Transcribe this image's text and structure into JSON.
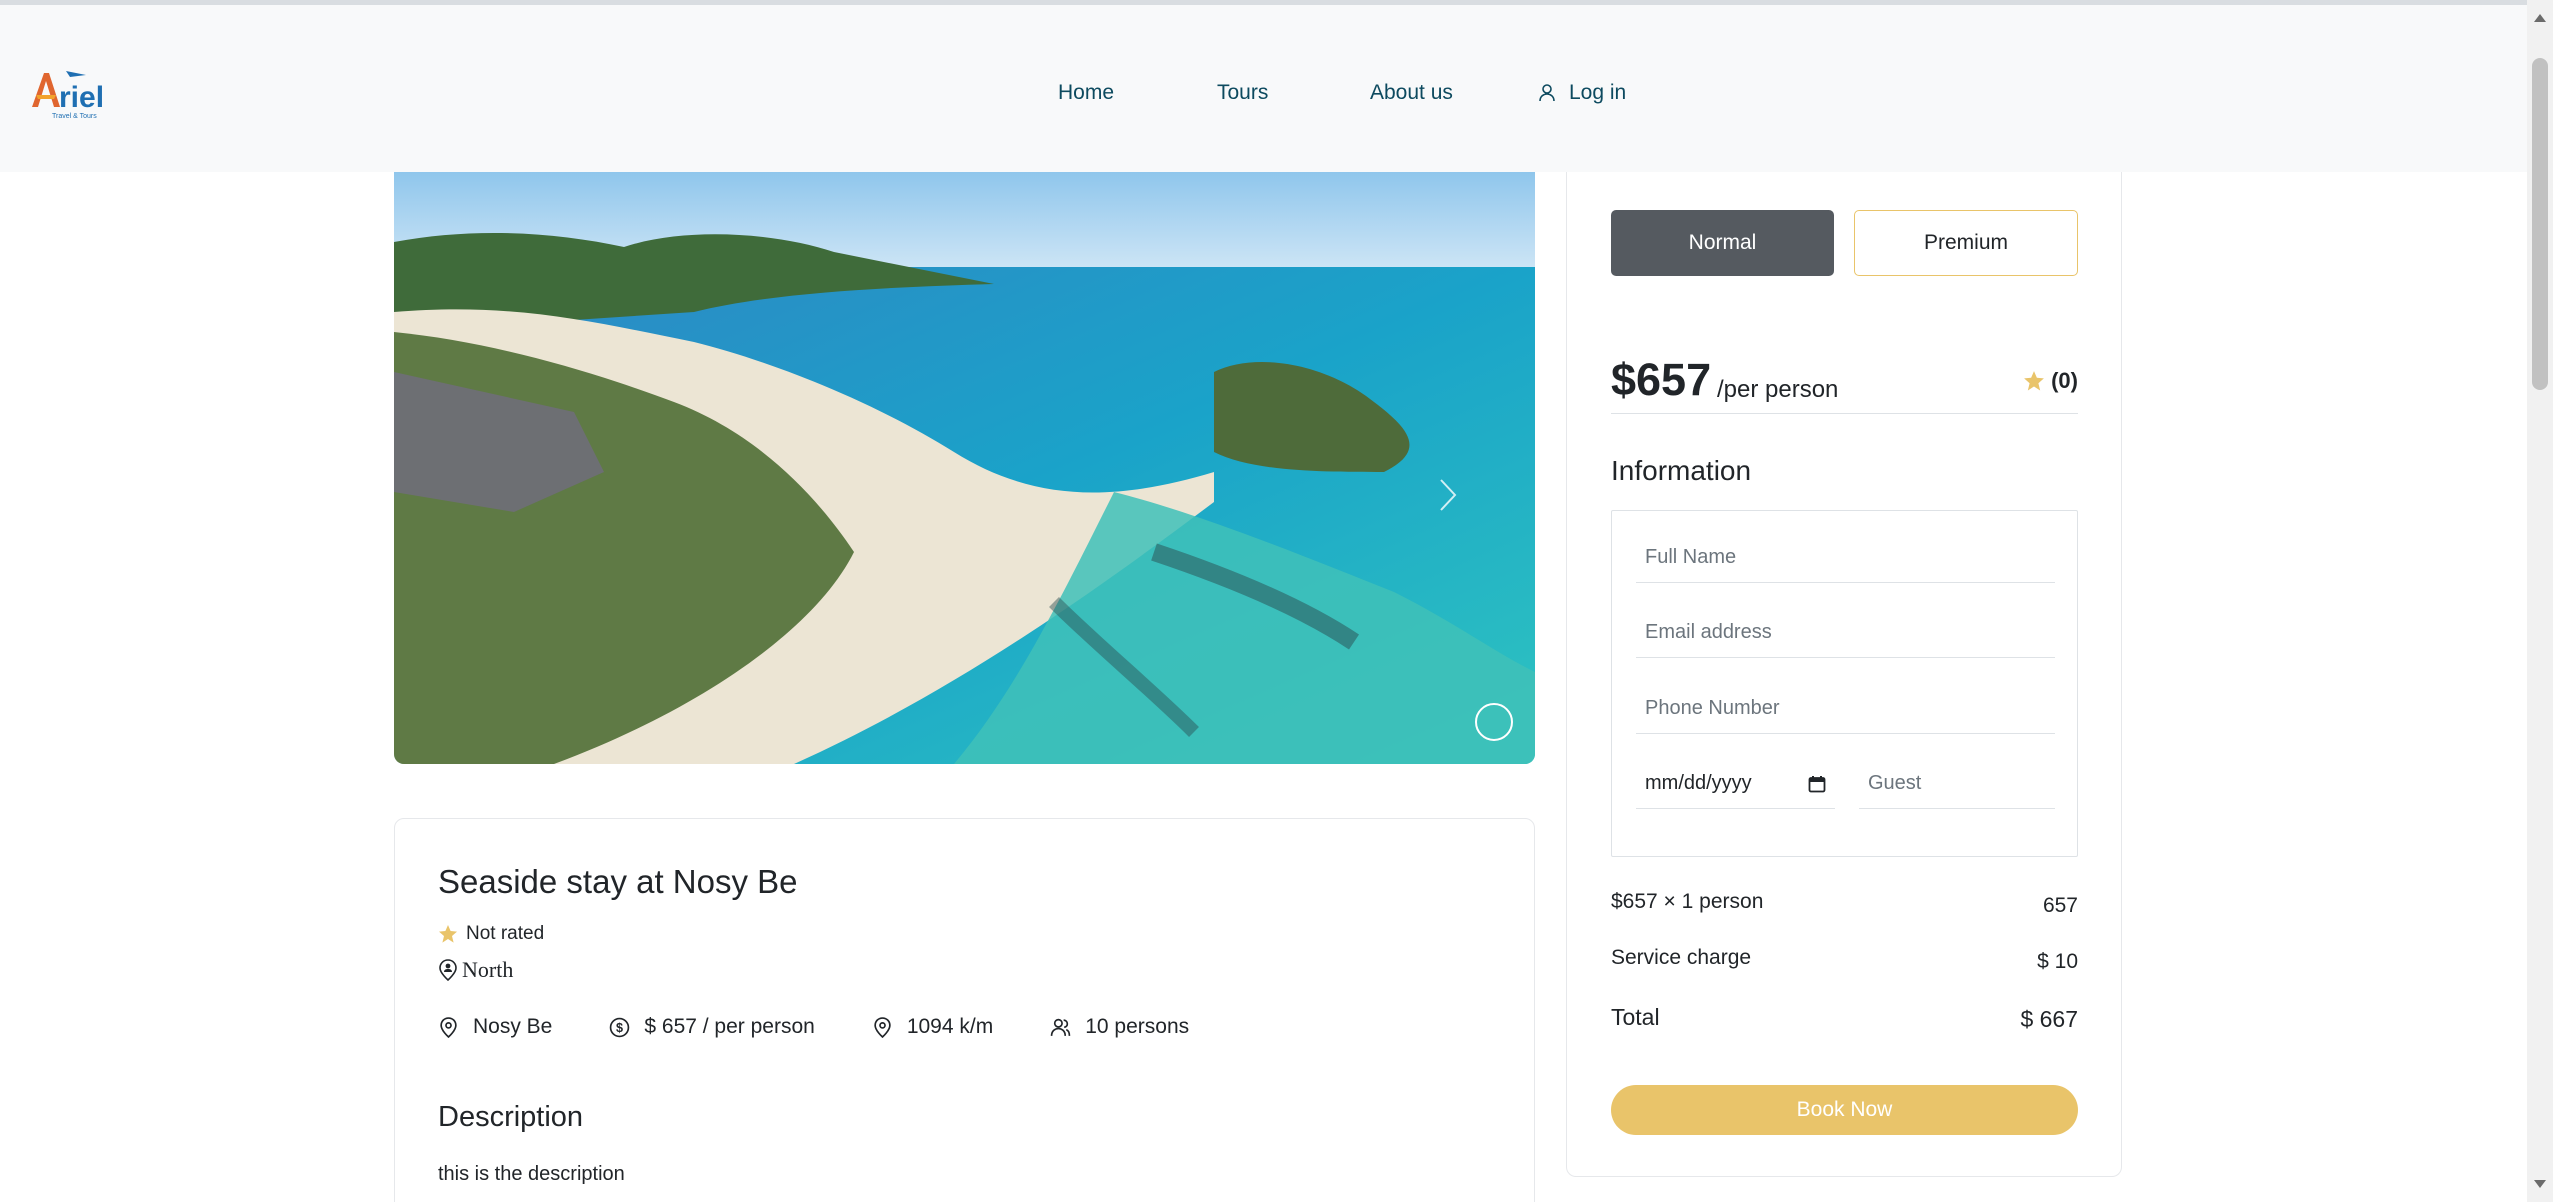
{
  "brand": {
    "logo_text": "Ariel",
    "logo_sub": "Travel & Tours",
    "logo_color": "#1f6fb2",
    "accent": "#e9c46a"
  },
  "nav": {
    "home": "Home",
    "tours": "Tours",
    "about": "About us",
    "login": "Log in",
    "login_icon": "user-icon"
  },
  "hero": {
    "image_desc_icon": "image",
    "next_icon": "chevron-right-icon"
  },
  "tour": {
    "title": "Seaside stay at Nosy Be",
    "rating_text": "Not rated",
    "region": "North",
    "meta": [
      {
        "icon": "map-pin-icon",
        "text": "Nosy Be"
      },
      {
        "icon": "dollar-circle-icon",
        "text": "$ 657 / per person"
      },
      {
        "icon": "map-pin-icon",
        "text": "1094 k/m"
      },
      {
        "icon": "users-icon",
        "text": "10 persons"
      }
    ],
    "description_title": "Description",
    "description": "this is the description"
  },
  "booking": {
    "tab_normal": "Normal",
    "tab_premium": "Premium",
    "price": "$657",
    "per": "/per person",
    "rating_count": "(0)",
    "info_title": "Information",
    "fields": {
      "full_name": "Full Name",
      "email": "Email address",
      "phone": "Phone Number",
      "date": "mm/dd/yyyy",
      "guest": "Guest"
    },
    "calc": [
      {
        "label": "$657 × 1 person",
        "value": "657"
      },
      {
        "label": "Service charge",
        "value": "$ 10"
      },
      {
        "label": "Total",
        "value": "$ 667"
      }
    ],
    "book_button": "Book Now"
  }
}
